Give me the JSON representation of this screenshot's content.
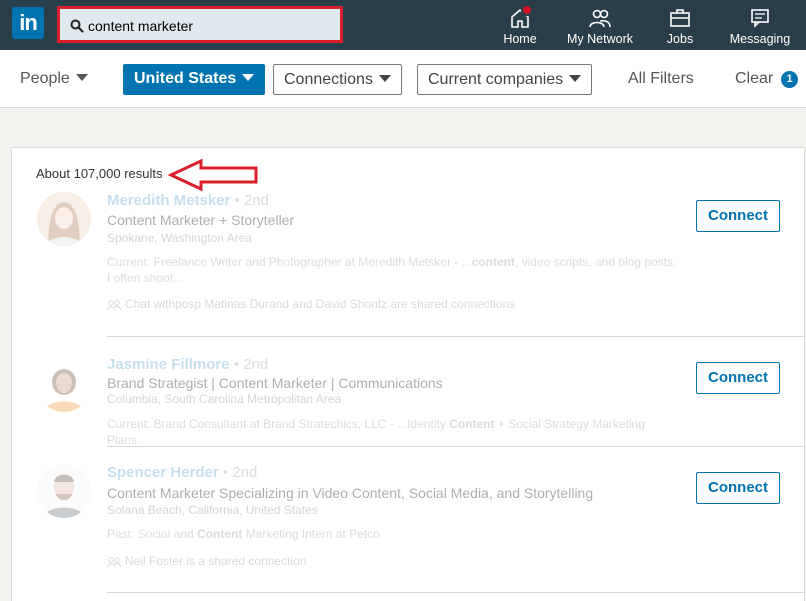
{
  "nav": {
    "logo": "in",
    "search": {
      "value": "content marketer",
      "placeholder": "Search"
    },
    "items": [
      {
        "label": "Home",
        "icon": "home-icon"
      },
      {
        "label": "My Network",
        "icon": "network-icon"
      },
      {
        "label": "Jobs",
        "icon": "jobs-icon"
      },
      {
        "label": "Messaging",
        "icon": "messaging-icon"
      }
    ]
  },
  "filters": {
    "people": "People",
    "location": "United States",
    "connections": "Connections",
    "companies": "Current companies",
    "all_filters": "All Filters",
    "clear": "Clear",
    "clear_count": "1"
  },
  "results": {
    "count_text": "About 107,000 results",
    "items": [
      {
        "name": "Meredith Metsker",
        "degree": "• 2nd",
        "title": "Content Marketer + Storyteller",
        "location": "Spokane, Washington Area",
        "desc_pre": "Current: Freelance Writer and Photographer at Meredith Metsker - ...",
        "desc_bold": "content",
        "desc_post": ", video scripts, and blog posts. I often shoot...",
        "shared": "Chat withposp Matinas Durand and David Shontz are shared connections",
        "action": "Connect"
      },
      {
        "name": "Jasmine Fillmore",
        "degree": "• 2nd",
        "title": "Brand Strategist | Content Marketer | Communications",
        "location": "Columbia, South Carolina Metropolitan Area",
        "desc_pre": "Current: Brand Consultant at Brand Stratechics, LLC - ...Identity ",
        "desc_bold": "Content",
        "desc_post": " + Social Strategy Marketing Plans",
        "shared": "",
        "action": "Connect"
      },
      {
        "name": "Spencer Herder",
        "degree": "• 2nd",
        "title": "Content Marketer Specializing in Video Content, Social Media, and Storytelling",
        "location": "Solana Beach, California, United States",
        "desc_pre": "Past: Social and ",
        "desc_bold": "Content",
        "desc_post": " Marketing Intern at Petco",
        "shared": "Neil Foster is a shared connection",
        "action": "Connect"
      }
    ]
  },
  "colors": {
    "nav_bg": "#283e4a",
    "brand": "#0073b1",
    "highlight": "#d9202a"
  }
}
